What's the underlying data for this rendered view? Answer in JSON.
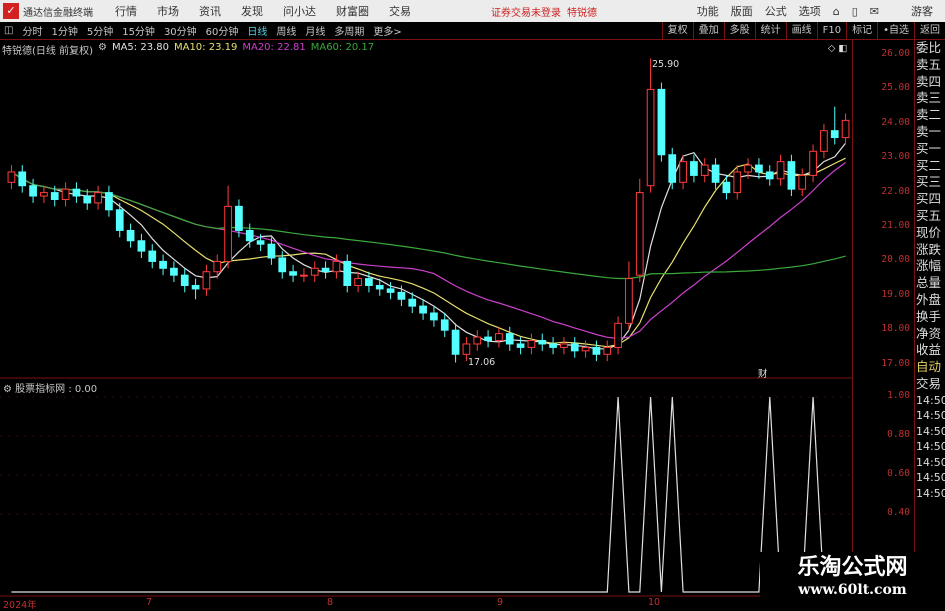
{
  "titlebar": {
    "app_name": "通达信金融终端",
    "menus": [
      "行情",
      "市场",
      "资讯",
      "发现",
      "问小达",
      "财富圈",
      "交易"
    ],
    "status": "证券交易未登录",
    "stock": "特锐德",
    "right_menus": [
      "功能",
      "版面",
      "公式",
      "选项"
    ],
    "user": "游客"
  },
  "toolbar": {
    "periods": [
      "分时",
      "1分钟",
      "5分钟",
      "15分钟",
      "30分钟",
      "60分钟",
      "日线",
      "周线",
      "月线",
      "多周期",
      "更多>"
    ],
    "active": "日线",
    "actions": [
      "复权",
      "叠加",
      "多股",
      "统计",
      "画线",
      "F10",
      "标记",
      "•自选",
      "返回"
    ]
  },
  "info": {
    "title": "特锐德(日线 前复权)",
    "ma5": "MA5: 23.80",
    "ma10": "MA10: 23.19",
    "ma20": "MA20: 22.81",
    "ma60": "MA60: 20.17"
  },
  "colors": {
    "up": "#ff3c3c",
    "down": "#54ffff",
    "ma5": "#e0e0e0",
    "ma10": "#e8e070",
    "ma20": "#cc40cc",
    "ma60": "#3aa83a",
    "axis": "#c03030"
  },
  "price_ticks": [
    "26.00",
    "25.00",
    "24.00",
    "23.00",
    "22.00",
    "21.00",
    "20.00",
    "19.00",
    "18.00",
    "17.00"
  ],
  "indicator": {
    "label": "股票指标网 : 0.00",
    "ticks": [
      "1.00",
      "0.80",
      "0.60",
      "0.40"
    ]
  },
  "annotations": {
    "high": "25.90",
    "low": "17.06",
    "marker": "财"
  },
  "x_labels": [
    "2024年",
    "7",
    "8",
    "9",
    "10"
  ],
  "right_panel": [
    "委比",
    "卖五",
    "卖四",
    "卖三",
    "卖二",
    "卖一",
    "买一",
    "买二",
    "买三",
    "买四",
    "买五",
    "现价",
    "涨跌",
    "涨幅",
    "总量",
    "外盘",
    "换手",
    "净资",
    "收益",
    "自动",
    "交易",
    "14:50",
    "14:50",
    "14:50",
    "14:50",
    "14:50",
    "14:50",
    "14:50"
  ],
  "watermark": {
    "name": "乐淘公式网",
    "url": "www.60lt.com"
  },
  "candles": {
    "open": [
      22.3,
      22.6,
      22.2,
      21.9,
      22.0,
      21.8,
      22.1,
      21.9,
      21.7,
      22.0,
      21.5,
      20.9,
      20.6,
      20.3,
      20.0,
      19.8,
      19.6,
      19.3,
      19.2,
      19.7,
      20.0,
      21.6,
      20.9,
      20.6,
      20.5,
      20.1,
      19.7,
      19.6,
      19.6,
      19.8,
      19.7,
      20.0,
      19.3,
      19.5,
      19.3,
      19.2,
      19.1,
      18.9,
      18.7,
      18.5,
      18.3,
      18.0,
      17.3,
      17.6,
      17.8,
      17.7,
      17.9,
      17.6,
      17.5,
      17.7,
      17.6,
      17.5,
      17.6,
      17.4,
      17.5,
      17.3,
      17.5,
      18.2,
      19.6,
      22.2,
      25.0,
      23.1,
      22.3,
      22.9,
      22.5,
      22.8,
      22.3,
      22.0,
      22.6,
      22.8,
      22.6,
      22.4,
      22.9,
      22.1,
      22.5,
      23.2,
      23.8,
      23.6
    ],
    "high": [
      22.8,
      22.8,
      22.4,
      22.2,
      22.2,
      22.3,
      22.3,
      22.1,
      22.2,
      22.2,
      21.7,
      21.1,
      20.8,
      20.5,
      20.2,
      20.0,
      19.8,
      19.5,
      19.9,
      20.2,
      22.2,
      21.8,
      21.1,
      20.8,
      20.7,
      20.3,
      19.9,
      19.8,
      20.0,
      20.0,
      20.2,
      20.2,
      19.7,
      19.7,
      19.5,
      19.4,
      19.3,
      19.1,
      18.9,
      18.7,
      18.5,
      18.2,
      17.8,
      18.0,
      18.0,
      18.1,
      18.1,
      17.8,
      17.9,
      17.9,
      17.8,
      17.8,
      17.8,
      17.7,
      17.7,
      17.7,
      18.4,
      20.0,
      22.4,
      25.9,
      25.2,
      23.3,
      23.1,
      23.1,
      23.0,
      23.0,
      22.5,
      22.8,
      23.0,
      23.0,
      22.8,
      23.1,
      23.1,
      22.7,
      23.4,
      24.0,
      24.5,
      24.3
    ],
    "low": [
      22.1,
      22.0,
      21.7,
      21.7,
      21.6,
      21.6,
      21.7,
      21.5,
      21.5,
      21.3,
      20.7,
      20.4,
      20.1,
      19.8,
      19.6,
      19.4,
      19.1,
      18.9,
      19.0,
      19.5,
      19.8,
      20.7,
      20.4,
      20.3,
      19.9,
      19.5,
      19.4,
      19.4,
      19.4,
      19.5,
      19.5,
      19.1,
      19.1,
      19.1,
      19.0,
      18.9,
      18.7,
      18.5,
      18.3,
      18.1,
      17.8,
      17.06,
      17.1,
      17.4,
      17.5,
      17.5,
      17.4,
      17.3,
      17.3,
      17.4,
      17.3,
      17.3,
      17.2,
      17.2,
      17.1,
      17.1,
      17.3,
      18.0,
      19.4,
      22.0,
      22.9,
      22.1,
      22.1,
      22.3,
      22.3,
      22.1,
      21.8,
      21.8,
      22.4,
      22.4,
      22.2,
      22.2,
      21.9,
      21.9,
      22.3,
      23.0,
      23.4,
      23.4
    ],
    "close": [
      22.6,
      22.2,
      21.9,
      22.0,
      21.8,
      22.1,
      21.9,
      21.7,
      22.0,
      21.5,
      20.9,
      20.6,
      20.3,
      20.0,
      19.8,
      19.6,
      19.3,
      19.2,
      19.7,
      20.0,
      21.6,
      20.9,
      20.6,
      20.5,
      20.1,
      19.7,
      19.6,
      19.6,
      19.8,
      19.7,
      20.0,
      19.3,
      19.5,
      19.3,
      19.2,
      19.1,
      18.9,
      18.7,
      18.5,
      18.3,
      18.0,
      17.3,
      17.6,
      17.8,
      17.7,
      17.9,
      17.6,
      17.5,
      17.7,
      17.6,
      17.5,
      17.6,
      17.4,
      17.5,
      17.3,
      17.5,
      18.2,
      19.5,
      22.0,
      25.0,
      23.1,
      22.3,
      22.9,
      22.5,
      22.8,
      22.3,
      22.0,
      22.6,
      22.8,
      22.6,
      22.4,
      22.9,
      22.1,
      22.5,
      23.2,
      23.8,
      23.6,
      24.1
    ]
  },
  "signal": [
    0,
    0,
    0,
    0,
    0,
    0,
    0,
    0,
    0,
    0,
    0,
    0,
    0,
    0,
    0,
    0,
    0,
    0,
    0,
    0,
    0,
    0,
    0,
    0,
    0,
    0,
    0,
    0,
    0,
    0,
    0,
    0,
    0,
    0,
    0,
    0,
    0,
    0,
    0,
    0,
    0,
    0,
    0,
    0,
    0,
    0,
    0,
    0,
    0,
    0,
    0,
    0,
    0,
    0,
    0,
    0,
    1,
    0,
    0,
    1,
    0,
    1,
    0,
    0,
    0,
    0,
    0,
    0,
    0,
    0,
    1,
    0,
    0,
    0,
    1,
    0,
    0,
    0
  ]
}
